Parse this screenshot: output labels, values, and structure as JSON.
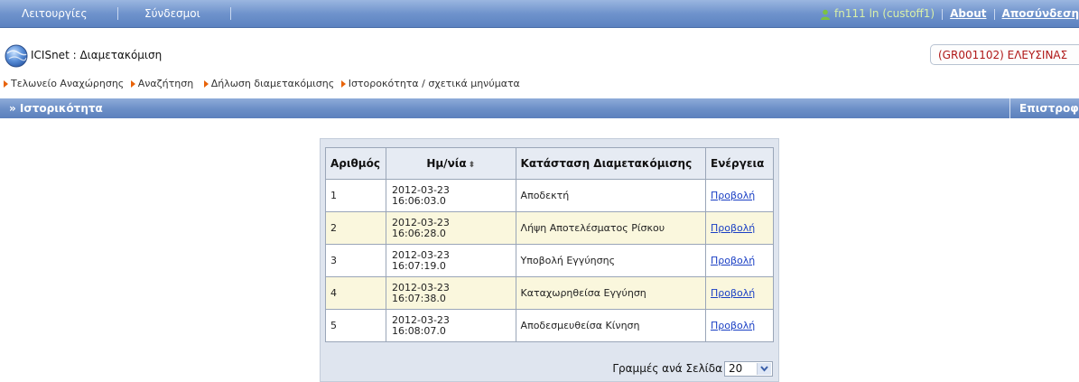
{
  "topbar": {
    "menu_operations": "Λειτουργίες",
    "menu_links": "Σύνδεσμοι",
    "user": "fn111 ln (custoff1)",
    "about": "About",
    "logout": "Αποσύνδεση"
  },
  "app": {
    "title": "ICISnet : Διαμετακόμιση",
    "office": "(GR001102) ΕΛΕΥΣΙΝΑΣ"
  },
  "breadcrumb": [
    "Τελωνείο Αναχώρησης",
    "Αναζήτηση",
    "Δήλωση διαμετακόμισης",
    "Ιστοροκότητα / σχετικά μηνύματα"
  ],
  "section": {
    "title": "» Ιστορικότητα",
    "return": "Επιστροφή"
  },
  "table": {
    "headers": [
      "Αριθμός",
      "Ημ/νία",
      "Κατάσταση Διαμετακόμισης",
      "Ενέργεια"
    ],
    "sort_icon": "⬍",
    "rows": [
      {
        "num": "1",
        "date": "2012-03-23",
        "time": "16:06:03.0",
        "status": "Αποδεκτή",
        "action": "Προβολή"
      },
      {
        "num": "2",
        "date": "2012-03-23",
        "time": "16:06:28.0",
        "status": "Λήψη Αποτελέσματος Ρίσκου",
        "action": "Προβολή"
      },
      {
        "num": "3",
        "date": "2012-03-23",
        "time": "16:07:19.0",
        "status": "Υποβολή Εγγύησης",
        "action": "Προβολή"
      },
      {
        "num": "4",
        "date": "2012-03-23",
        "time": "16:07:38.0",
        "status": "Καταχωρηθείσα Εγγύηση",
        "action": "Προβολή"
      },
      {
        "num": "5",
        "date": "2012-03-23",
        "time": "16:08:07.0",
        "status": "Αποδεσμευθείσα Κίνηση",
        "action": "Προβολή"
      }
    ]
  },
  "pager": {
    "label": "Γραμμές ανά Σελίδα",
    "value": "20"
  },
  "colors": {
    "topbar": "#6f93cc",
    "office_text": "#b01818",
    "breadcrumb_arrow": "#e8630a",
    "alt_row": "#faf7dd",
    "link": "#1a3fc4"
  }
}
